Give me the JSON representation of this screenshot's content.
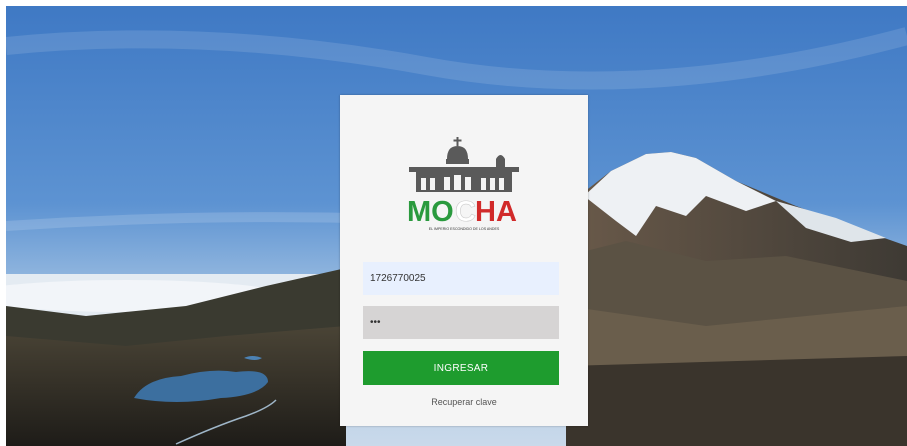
{
  "logo": {
    "name": "MOCHA",
    "tagline": "EL IMPERIO ESCONDIDO DE LOS ANDES",
    "icon": "church-icon",
    "colors": {
      "green": "#2a9a3e",
      "white": "#ffffff",
      "red": "#d12a2a",
      "gray": "#5a5a5a"
    }
  },
  "login": {
    "username_value": "1726770025",
    "password_value": "•••",
    "submit_label": "INGRESAR",
    "recover_label": "Recuperar clave"
  },
  "colors": {
    "button": "#1e9c2e",
    "card": "#f5f5f5"
  }
}
